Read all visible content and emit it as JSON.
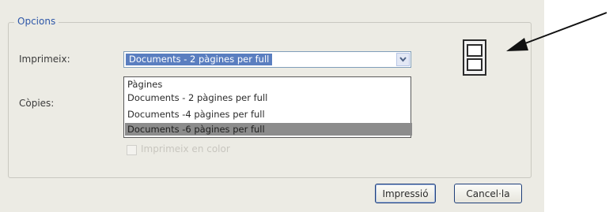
{
  "group": {
    "title": "Opcions"
  },
  "labels": {
    "print": "Imprimeix:",
    "copies": "Còpies:"
  },
  "print_select": {
    "selected": "Documents - 2 pàgines per full",
    "options": [
      "Pàgines",
      "Documents - 2 pàgines per full",
      "Documents -4 pàgines per full",
      "Documents -6 pàgines per full"
    ],
    "highlighted_index": 3
  },
  "color_checkbox": {
    "label": "Imprimeix en color",
    "checked": false,
    "enabled": false
  },
  "buttons": {
    "print": "Impressió",
    "cancel": "Cancel·la"
  },
  "icons": {
    "dropdown": "chevron-down-icon",
    "layout": "two-page-layout-icon",
    "annotation": "arrow-pointer-icon"
  },
  "colors": {
    "accent": "#2e57a8",
    "selection": "#5a7ec0",
    "hover": "#8c8c8c"
  }
}
